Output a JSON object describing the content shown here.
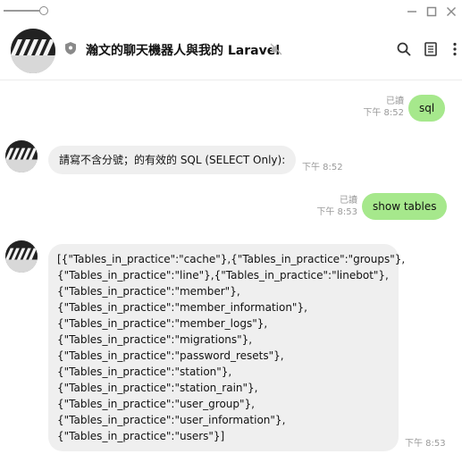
{
  "window": {
    "controls": [
      "minimize",
      "maximize",
      "close"
    ]
  },
  "header": {
    "title": "瀚文的聊天機器人與我的 Laravel",
    "icons": [
      "shield-icon",
      "mute-icon",
      "search-icon",
      "notes-icon",
      "more-icon"
    ]
  },
  "messages": [
    {
      "direction": "out",
      "text": "sql",
      "read_label": "已讀",
      "time": "下午 8:52"
    },
    {
      "direction": "in",
      "text": "請寫不含分號；的有效的 SQL (SELECT Only):",
      "time": "下午 8:52"
    },
    {
      "direction": "out",
      "text": "show tables",
      "read_label": "已讀",
      "time": "下午 8:53"
    },
    {
      "direction": "in",
      "lines": [
        "[{\"Tables_in_practice\":\"cache\"},{\"Tables_in_practice\":\"groups\"},",
        "{\"Tables_in_practice\":\"line\"},{\"Tables_in_practice\":\"linebot\"},",
        "{\"Tables_in_practice\":\"member\"},",
        "{\"Tables_in_practice\":\"member_information\"},",
        "{\"Tables_in_practice\":\"member_logs\"},",
        "{\"Tables_in_practice\":\"migrations\"},",
        "{\"Tables_in_practice\":\"password_resets\"},",
        "{\"Tables_in_practice\":\"station\"},",
        "{\"Tables_in_practice\":\"station_rain\"},",
        "{\"Tables_in_practice\":\"user_group\"},",
        "{\"Tables_in_practice\":\"user_information\"},",
        "{\"Tables_in_practice\":\"users\"}]"
      ],
      "time": "下午 8:53"
    }
  ],
  "colors": {
    "outgoing_bubble": "#a6e88c",
    "incoming_bubble": "#efefef",
    "meta_text": "#9a9a9a"
  }
}
